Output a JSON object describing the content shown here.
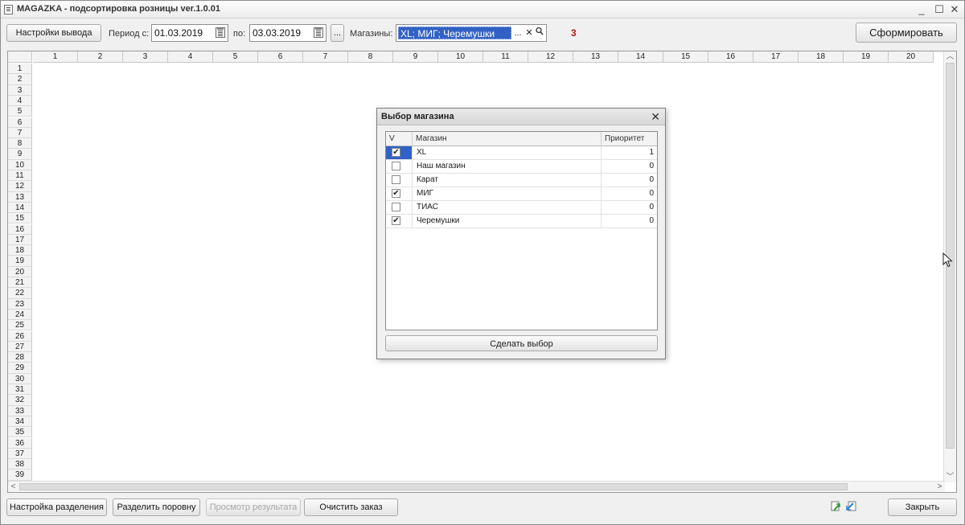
{
  "window": {
    "title": "MAGAZKA - подсортировка розницы ver.1.0.01",
    "minimize": "_",
    "maximize": "☐",
    "close": "✕"
  },
  "toolbar": {
    "output_settings_label": "Настройки вывода",
    "period_from_label": "Период с:",
    "date_from": "01.03.2019",
    "period_to_label": "по:",
    "date_to": "03.03.2019",
    "period_picker_label": "...",
    "stores_label": "Магазины:",
    "stores_value": "XL; МИГ; Черемушки",
    "stores_choose": "...",
    "stores_clear": "✕",
    "selected_count": "3",
    "generate_label": "Сформировать"
  },
  "sheet": {
    "columns": [
      "1",
      "2",
      "3",
      "4",
      "5",
      "6",
      "7",
      "8",
      "9",
      "10",
      "11",
      "12",
      "13",
      "14",
      "15",
      "16",
      "17",
      "18",
      "19",
      "20"
    ],
    "rows": [
      "1",
      "2",
      "3",
      "4",
      "5",
      "6",
      "7",
      "8",
      "9",
      "10",
      "11",
      "12",
      "13",
      "14",
      "15",
      "16",
      "17",
      "18",
      "19",
      "20",
      "21",
      "22",
      "23",
      "24",
      "25",
      "26",
      "27",
      "28",
      "29",
      "30",
      "31",
      "32",
      "33",
      "34",
      "35",
      "36",
      "37",
      "38",
      "39"
    ]
  },
  "dialog": {
    "title": "Выбор магазина",
    "close": "✕",
    "columns": {
      "check": "V",
      "store": "Магазин",
      "priority": "Приоритет"
    },
    "rows": [
      {
        "checked": true,
        "store": "XL",
        "priority": "1",
        "selected": true
      },
      {
        "checked": false,
        "store": "Наш магазин",
        "priority": "0",
        "selected": false
      },
      {
        "checked": false,
        "store": "Карат",
        "priority": "0",
        "selected": false
      },
      {
        "checked": true,
        "store": "МИГ",
        "priority": "0",
        "selected": false
      },
      {
        "checked": false,
        "store": "ТИАС",
        "priority": "0",
        "selected": false
      },
      {
        "checked": true,
        "store": "Черемушки",
        "priority": "0",
        "selected": false
      }
    ],
    "confirm_label": "Сделать выбор"
  },
  "bottom": {
    "split_settings_label": "Настройка разделения",
    "split_evenly_label": "Разделить поровну",
    "preview_result_label": "Просмотр результата",
    "clear_order_label": "Очистить заказ",
    "close_label": "Закрыть"
  },
  "colors": {
    "selection": "#3161c4",
    "count": "#b01616"
  },
  "icons": [
    "calendar-icon",
    "search-icon",
    "clear-icon",
    "export-icon",
    "import-icon",
    "cursor-icon"
  ]
}
